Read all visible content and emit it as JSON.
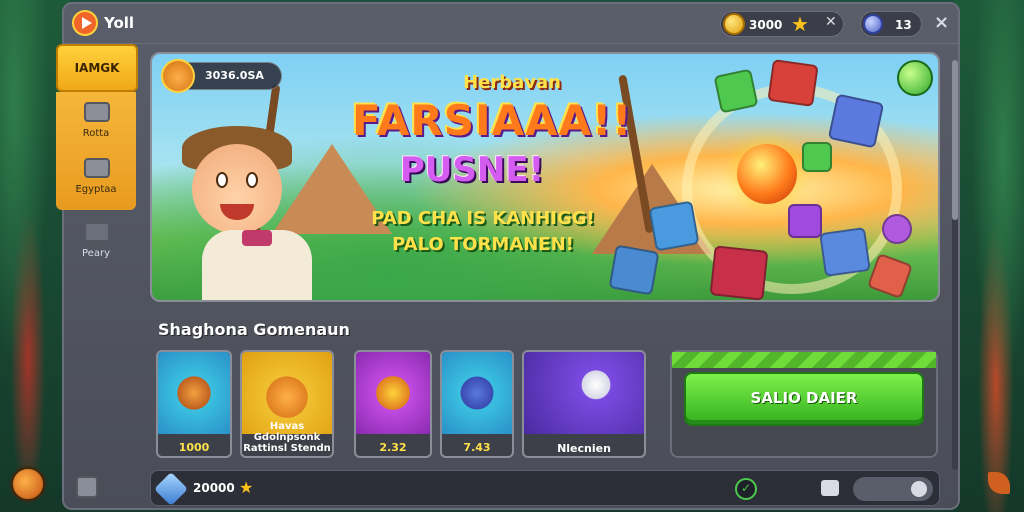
{
  "titlebar": {
    "app_title": "Yoll",
    "coins": "3000",
    "gems": "13",
    "close_glyph": "×"
  },
  "sidebar": {
    "active_tab": "IAMGK",
    "items": [
      {
        "label": "Rotta",
        "icon": "box-icon"
      },
      {
        "label": "Egyptaa",
        "icon": "chest-icon"
      },
      {
        "label": "Peary",
        "icon": "chat-icon"
      }
    ]
  },
  "banner": {
    "player_id": "3036.0SA",
    "headline_small": "Herbavan",
    "headline_big": "FARSIAAA!!",
    "headline_purple": "PUSNE!",
    "sub_line1": "PAD CHA IS KANHIGG!",
    "sub_line2": "PALO TORMANEN!"
  },
  "section": {
    "title": "Shaghona Gomenaun"
  },
  "cards": [
    {
      "label": "1000",
      "art": "bear-icon"
    },
    {
      "label": "Havas Gdolnpsonk Rattinsl Stendn",
      "art": "bear-icon"
    },
    {
      "label": "2.32",
      "art": "treasure-chest-icon"
    },
    {
      "label": "7.43",
      "art": "robot-icon"
    },
    {
      "label": "Nlecnien",
      "art": "bird-icon"
    }
  ],
  "cta": {
    "label": "SALIO DAIER"
  },
  "bottom_bar": {
    "gem_value": "20000"
  },
  "colors": {
    "accent": "#ffd13a",
    "cta_green": "#33b020",
    "window_bg": "#4a4d57"
  }
}
